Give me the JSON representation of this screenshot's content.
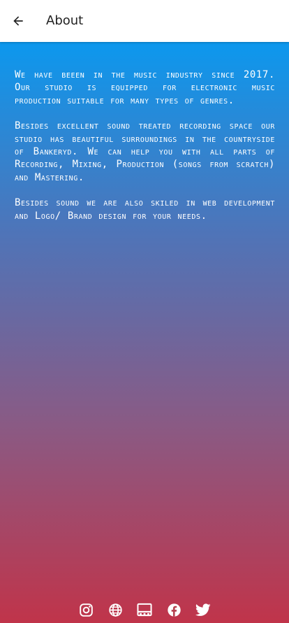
{
  "app_bar": {
    "title": "About",
    "back_icon": "arrow-left-icon"
  },
  "about": {
    "paragraphs": [
      "We have beeen in the music industry since 2017. Our studio is equipped for electronic music production suitable for many types of genres.",
      "Besides excellent sound treated recording space our studio has beautiful surroundings in the countryside of Bankeryd. We can help you with all parts of Recording, Mixing, Production (songs from scratch) and Mastering.",
      "Besides sound we are also skiled in web development and Logo/ Brand design for your needs."
    ]
  },
  "social": {
    "icons": [
      "instagram-icon",
      "globe-icon",
      "media-card-icon",
      "facebook-icon",
      "twitter-icon"
    ]
  },
  "colors": {
    "gradient_top": "#0c98ee",
    "gradient_bottom": "#c0344a",
    "app_bar_bg": "#ffffff",
    "text": "#ffffff"
  }
}
